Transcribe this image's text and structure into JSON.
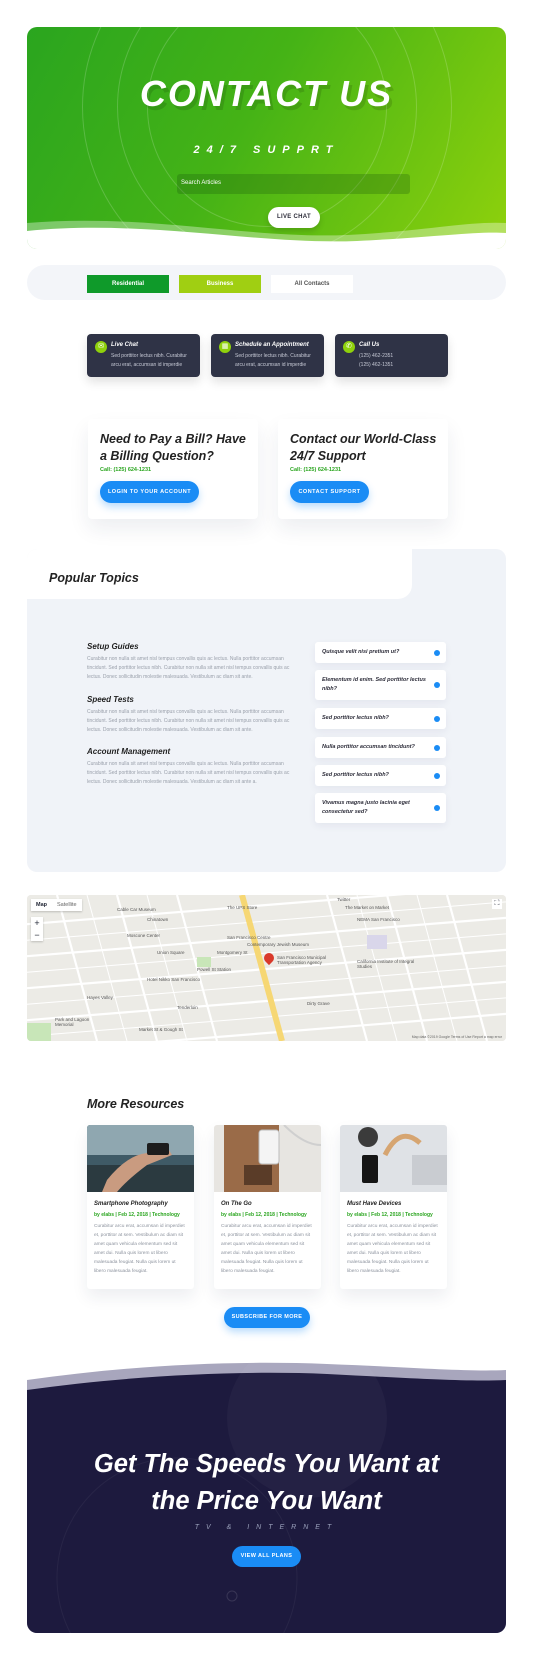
{
  "hero": {
    "title": "CONTACT US",
    "subtitle": "24/7 SUPPRT",
    "search_placeholder": "Search Articles",
    "live_chat_button": "LIVE CHAT"
  },
  "tabs": [
    {
      "label": "Residential"
    },
    {
      "label": "Business"
    },
    {
      "label": "All Contacts"
    }
  ],
  "contact_cards": [
    {
      "title": "Live Chat",
      "text": "Sed porttitor lectus nibh. Curabitur arcu erat, accumsan id imperdie",
      "icon": "chat-icon"
    },
    {
      "title": "Schedule an Appointment",
      "text": "Sed porttitor lectus nibh. Curabitur arcu erat, accumsan id imperdie",
      "icon": "calendar-icon"
    },
    {
      "title": "Call Us",
      "text": "(125) 462-2351\n(125) 462-1351",
      "icon": "phone-icon"
    }
  ],
  "billing": {
    "title": "Need to Pay a Bill? Have a Billing Question?",
    "call": "Call: (125) 624-1231",
    "button": "LOGIN TO YOUR ACCOUNT"
  },
  "support": {
    "title": "Contact our World-Class 24/7 Support",
    "call": "Call: (125) 624-1231",
    "button": "CONTACT SUPPORT"
  },
  "popular": {
    "title": "Popular Topics",
    "sections": [
      {
        "heading": "Setup Guides",
        "text": "Curabitur non nulla sit amet nisl tempus convallis quis ac lectus. Nulla porttitor accumsan tincidunt. Sed porttitor lectus nibh. Curabitur non nulla sit amet nisl tempus convallis quis ac lectus. Donec sollicitudin molestie malesuada. Vestibulum ac diam sit ante."
      },
      {
        "heading": "Speed Tests",
        "text": "Curabitur non nulla sit amet nisl tempus convallis quis ac lectus. Nulla porttitor accumsan tincidunt. Sed porttitor lectus nibh. Curabitur non nulla sit amet nisl tempus convallis quis ac lectus. Donec sollicitudin molestie malesuada. Vestibulum ac diam sit ante."
      },
      {
        "heading": "Account Management",
        "text": "Curabitur non nulla sit amet nisl tempus convallis quis ac lectus. Nulla porttitor accumsan tincidunt. Sed porttitor lectus nibh. Curabitur non nulla sit amet nisl tempus convallis quis ac lectus. Donec sollicitudin molestie malesuada. Vestibulum ac diam sit ante a."
      }
    ],
    "questions": [
      "Quisque velit nisi pretium ut?",
      "Elementum id enim. Sed porttitor lectus nibh?",
      "Sed porttitor lectus nibh?",
      "Nulla porttitor accumsan tincidunt?",
      "Sed porttitor lectus nibh?",
      "Vivamus magna justo lacinia eget consectetur sed?"
    ]
  },
  "map": {
    "type_map": "Map",
    "type_satellite": "Satellite",
    "zoom_in": "+",
    "zoom_out": "−",
    "labels": [
      "Twitter",
      "The Market on Market",
      "The UPS Store",
      "NEMA San Francisco",
      "San Francisco Centre",
      "Contemporary Jewish Museum",
      "Moscone Center",
      "Montgomery St",
      "San Francisco Municipal Transportation Agency",
      "California Institute of Integral Studies",
      "Cable Car Museum",
      "Powell St Station",
      "Union Square",
      "Hotel Nikko San Francisco",
      "Park and Lagoon Memorial",
      "Dirty Grave",
      "Market St & Gough St",
      "Chinatown",
      "Hayes Valley",
      "Tenderloin"
    ],
    "footer": "Map data ©2019 Google   Terms of Use   Report a map error"
  },
  "resources": {
    "title": "More Resources",
    "cards": [
      {
        "title": "Smartphone Photography",
        "meta": "by elabs | Feb 12, 2018 | Technology",
        "text": "Curabitur arcu erat, accumsan id imperdiet et, porttitor at sem. Vestibulum ac diam sit amet quam vehicula elementum sed sit amet dui. Nulla quis lorem ut libero malesuada feugiat. Nulla quis lorem ut libero malesuada feugiat."
      },
      {
        "title": "On The Go",
        "meta": "by elabs | Feb 12, 2018 | Technology",
        "text": "Curabitur arcu erat, accumsan id imperdiet et, porttitor at sem. Vestibulum ac diam sit amet quam vehicula elementum sed sit amet dui. Nulla quis lorem ut libero malesuada feugiat. Nulla quis lorem ut libero malesuada feugiat."
      },
      {
        "title": "Must Have Devices",
        "meta": "by elabs | Feb 12, 2018 | Technology",
        "text": "Curabitur arcu erat, accumsan id imperdiet et, porttitor at sem. Vestibulum ac diam sit amet quam vehicula elementum sed sit amet dui. Nulla quis lorem ut libero malesuada feugiat. Nulla quis lorem ut libero malesuada feugiat."
      }
    ],
    "subscribe_button": "SUBSCRIBE FOR MORE"
  },
  "footer": {
    "title_line1": "Get The Speeds You Want at",
    "title_line2": "the Price You Want",
    "subtitle": "TV & INTERNET",
    "button": "VIEW ALL PLANS"
  },
  "colors": {
    "green_dark": "#2aa51f",
    "green_light": "#8fd10c",
    "accent_blue": "#1a8cf5",
    "card_dark": "#2f3346",
    "footer_navy": "#1d1a3e"
  }
}
